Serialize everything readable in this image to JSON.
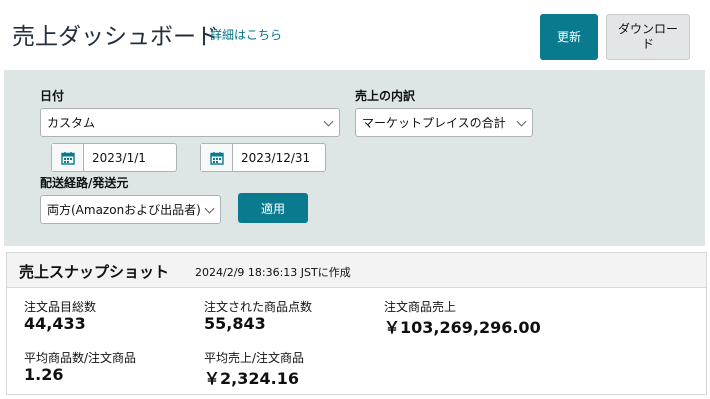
{
  "header": {
    "title": "売上ダッシュボード",
    "detail_link": "詳細はこちら",
    "refresh_label": "更新",
    "download_label": "ダウンロード"
  },
  "filters": {
    "date_label": "日付",
    "date_range_value": "カスタム",
    "start_date": "2023/1/1",
    "end_date": "2023/12/31",
    "breakdown_label": "売上の内訳",
    "breakdown_value": "マーケットプレイスの合計",
    "fulfillment_label": "配送経路/発送元",
    "fulfillment_value": "両方(Amazonおよび出品者)",
    "apply_label": "適用"
  },
  "snapshot": {
    "title": "売上スナップショット",
    "timestamp": "2024/2/9 18:36:13 JSTに作成",
    "metrics": [
      {
        "label": "注文品目総数",
        "value": "44,433"
      },
      {
        "label": "注文された商品点数",
        "value": "55,843"
      },
      {
        "label": "注文商品売上",
        "value": "￥103,269,296.00"
      },
      {
        "label": "平均商品数/注文商品",
        "value": "1.26"
      },
      {
        "label": "平均売上/注文商品",
        "value": "￥2,324.16"
      }
    ]
  },
  "colors": {
    "accent": "#0a7b8f",
    "filter_background": "#dde5e5",
    "link": "#007185"
  },
  "icons": {
    "calendar": "calendar-icon",
    "dropdown": "chevron-down-icon"
  }
}
